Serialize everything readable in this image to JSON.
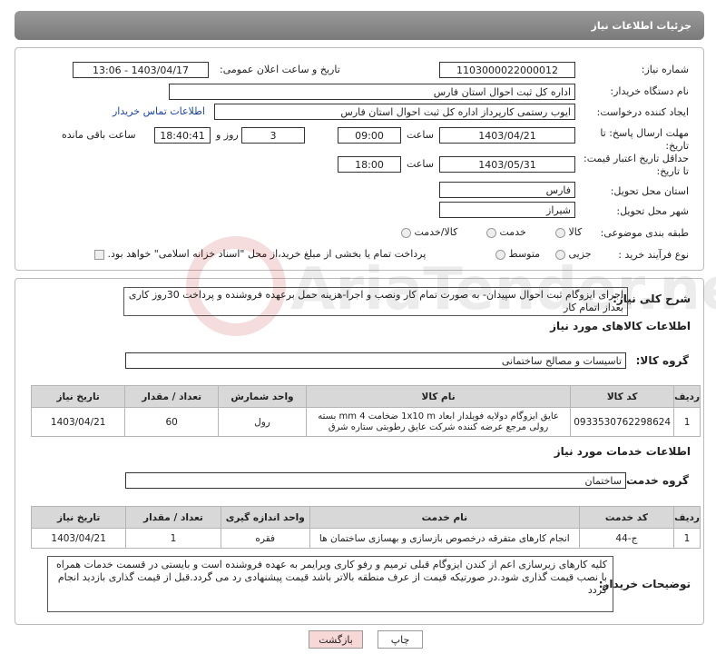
{
  "header": {
    "title": "جزئیات اطلاعات نیاز"
  },
  "form": {
    "need_number_label": "شماره نیاز:",
    "need_number": "1103000022000012",
    "announce_label": "تاریخ و ساعت اعلان عمومی:",
    "announce_value": "1403/04/17 - 13:06",
    "buyer_org_label": "نام دستگاه خریدار:",
    "buyer_org": "اداره کل ثبت احوال استان فارس",
    "creator_label": "ایجاد کننده درخواست:",
    "creator": "ایوب رستمی کارپرداز اداره کل ثبت احوال استان فارس",
    "contact_link": "اطلاعات تماس خریدار",
    "deadline_label": "مهلت ارسال پاسخ: تا تاریخ:",
    "deadline_date": "1403/04/21",
    "time_label": "ساعت",
    "deadline_time": "09:00",
    "days_value": "3",
    "days_label": "روز و",
    "remaining_time": "18:40:41",
    "remaining_label": "ساعت باقی مانده",
    "price_valid_label": "حداقل تاریخ اعتبار قیمت: تا تاریخ:",
    "price_valid_date": "1403/05/31",
    "price_valid_time": "18:00",
    "province_label": "استان محل تحویل:",
    "province": "فارس",
    "city_label": "شهر محل تحویل:",
    "city": "شیراز",
    "category_label": "طبقه بندی موضوعی:",
    "category_options": [
      "کالا",
      "خدمت",
      "کالا/خدمت"
    ],
    "process_label": "نوع فرآیند خرید :",
    "process_options": [
      "جزیی",
      "متوسط"
    ],
    "payment_note": "پرداخت تمام یا بخشی از مبلغ خرید،از محل \"اسناد خزانه اسلامی\" خواهد بود."
  },
  "description": {
    "label": "شرح کلی نیاز:",
    "text": "اجرای ایزوگام ثبت احوال سپیدان- به صورت تمام کار ونصب و اجرا-هزینه حمل برعهده فروشنده و پرداخت 30روز کاری بعداز اتمام کار"
  },
  "goods": {
    "section_title": "اطلاعات کالاهای مورد نیاز",
    "group_label": "گروه کالا:",
    "group_value": "تاسیسات و مصالح ساختمانی",
    "headers": [
      "ردیف",
      "کد کالا",
      "نام کالا",
      "واحد شمارش",
      "تعداد / مقدار",
      "تاریخ نیاز"
    ],
    "rows": [
      [
        "1",
        "0933530762298624",
        "عایق ایزوگام دولایه فویلدار ابعاد 1x10 m ضخامت 4 mm بسته رولی مرجع عرضه کننده شرکت عایق رطوبتی ستاره شرق",
        "رول",
        "60",
        "1403/04/21"
      ]
    ]
  },
  "services": {
    "section_title": "اطلاعات خدمات مورد نیاز",
    "group_label": "گروه خدمت:",
    "group_value": "ساختمان",
    "headers": [
      "ردیف",
      "کد خدمت",
      "نام خدمت",
      "واحد اندازه گیری",
      "تعداد / مقدار",
      "تاریخ نیاز"
    ],
    "rows": [
      [
        "1",
        "ج-44",
        "انجام کارهای متفرقه درخصوص بازسازی و بهسازی ساختمان ها",
        "فقره",
        "1",
        "1403/04/21"
      ]
    ]
  },
  "buyer_notes": {
    "label": "توضیحات خریدار:",
    "text": "کلیه کارهای  زیرسازی اعم از کندن ایزوگام قبلی ترمیم و رفو کاری ویرایمر به عهده فروشنده است و بایستی در قسمت خدمات همراه با نصب قیمت گذاری شود.در صورتیکه قیمت از عرف منطقه بالاتر باشد قیمت پیشنهادی رد می گردد.قبل از قیمت گذاری بازدید انجام گردد"
  },
  "buttons": {
    "print": "چاپ",
    "back": "بازگشت"
  },
  "watermark": {
    "text": "AriaTender.net"
  }
}
